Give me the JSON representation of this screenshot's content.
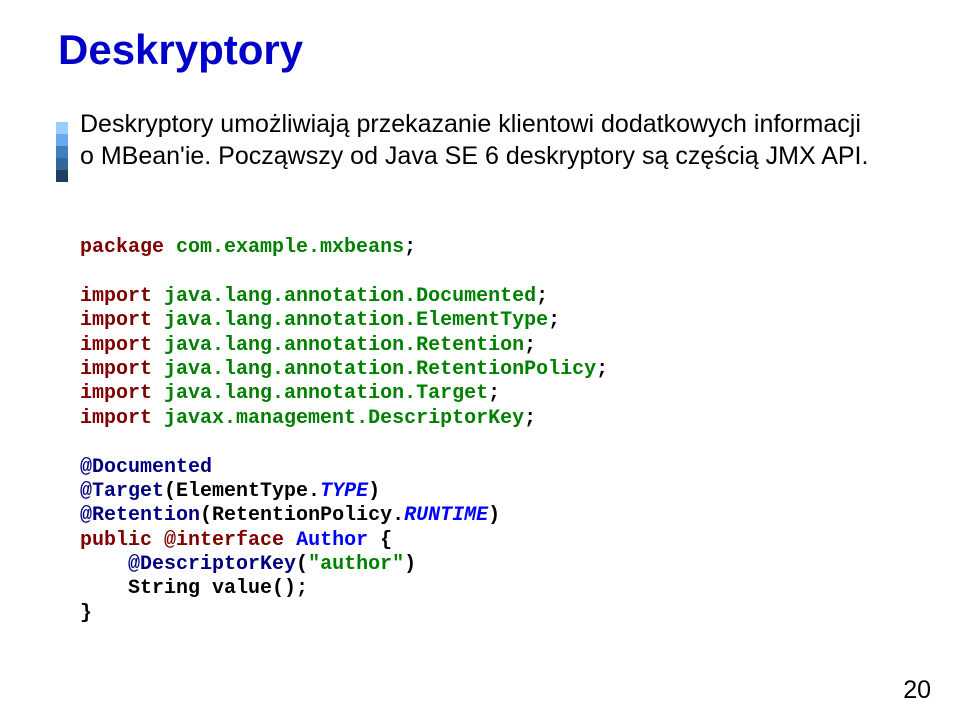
{
  "title": "Deskryptory",
  "body": "Deskryptory umożliwiają przekazanie klientowi dodatkowych informacji o MBean'ie. Począwszy od Java SE 6 deskryptory są częścią JMX API.",
  "code": {
    "kw_package": "package",
    "pkg_name": "com.example.mxbeans",
    "semi": ";",
    "kw_import": "import",
    "imp1": "java.lang.annotation.Documented",
    "imp2": "java.lang.annotation.ElementType",
    "imp3": "java.lang.annotation.Retention",
    "imp4": "java.lang.annotation.RetentionPolicy",
    "imp5": "java.lang.annotation.Target",
    "imp6": "javax.management.DescriptorKey",
    "ann_documented": "@Documented",
    "ann_target": "@Target",
    "ann_retention": "@Retention",
    "ann_descriptorkey": "@DescriptorKey",
    "elemtype_prefix": "ElementType.",
    "elemtype_const": "TYPE",
    "retpolicy_prefix": "RetentionPolicy.",
    "retpolicy_const": "RUNTIME",
    "kw_public": "public",
    "kw_atinterface": "@interface",
    "cls_author": "Author",
    "brace_open": " {",
    "dk_literal": "\"author\"",
    "ret_line": "    String value();",
    "brace_close": "}",
    "lparen": "(",
    "rparen": ")"
  },
  "page_number": "20",
  "stripe_colors": [
    "#99ccff",
    "#66aaee",
    "#3f7fbf",
    "#336699",
    "#1f3f5f"
  ]
}
